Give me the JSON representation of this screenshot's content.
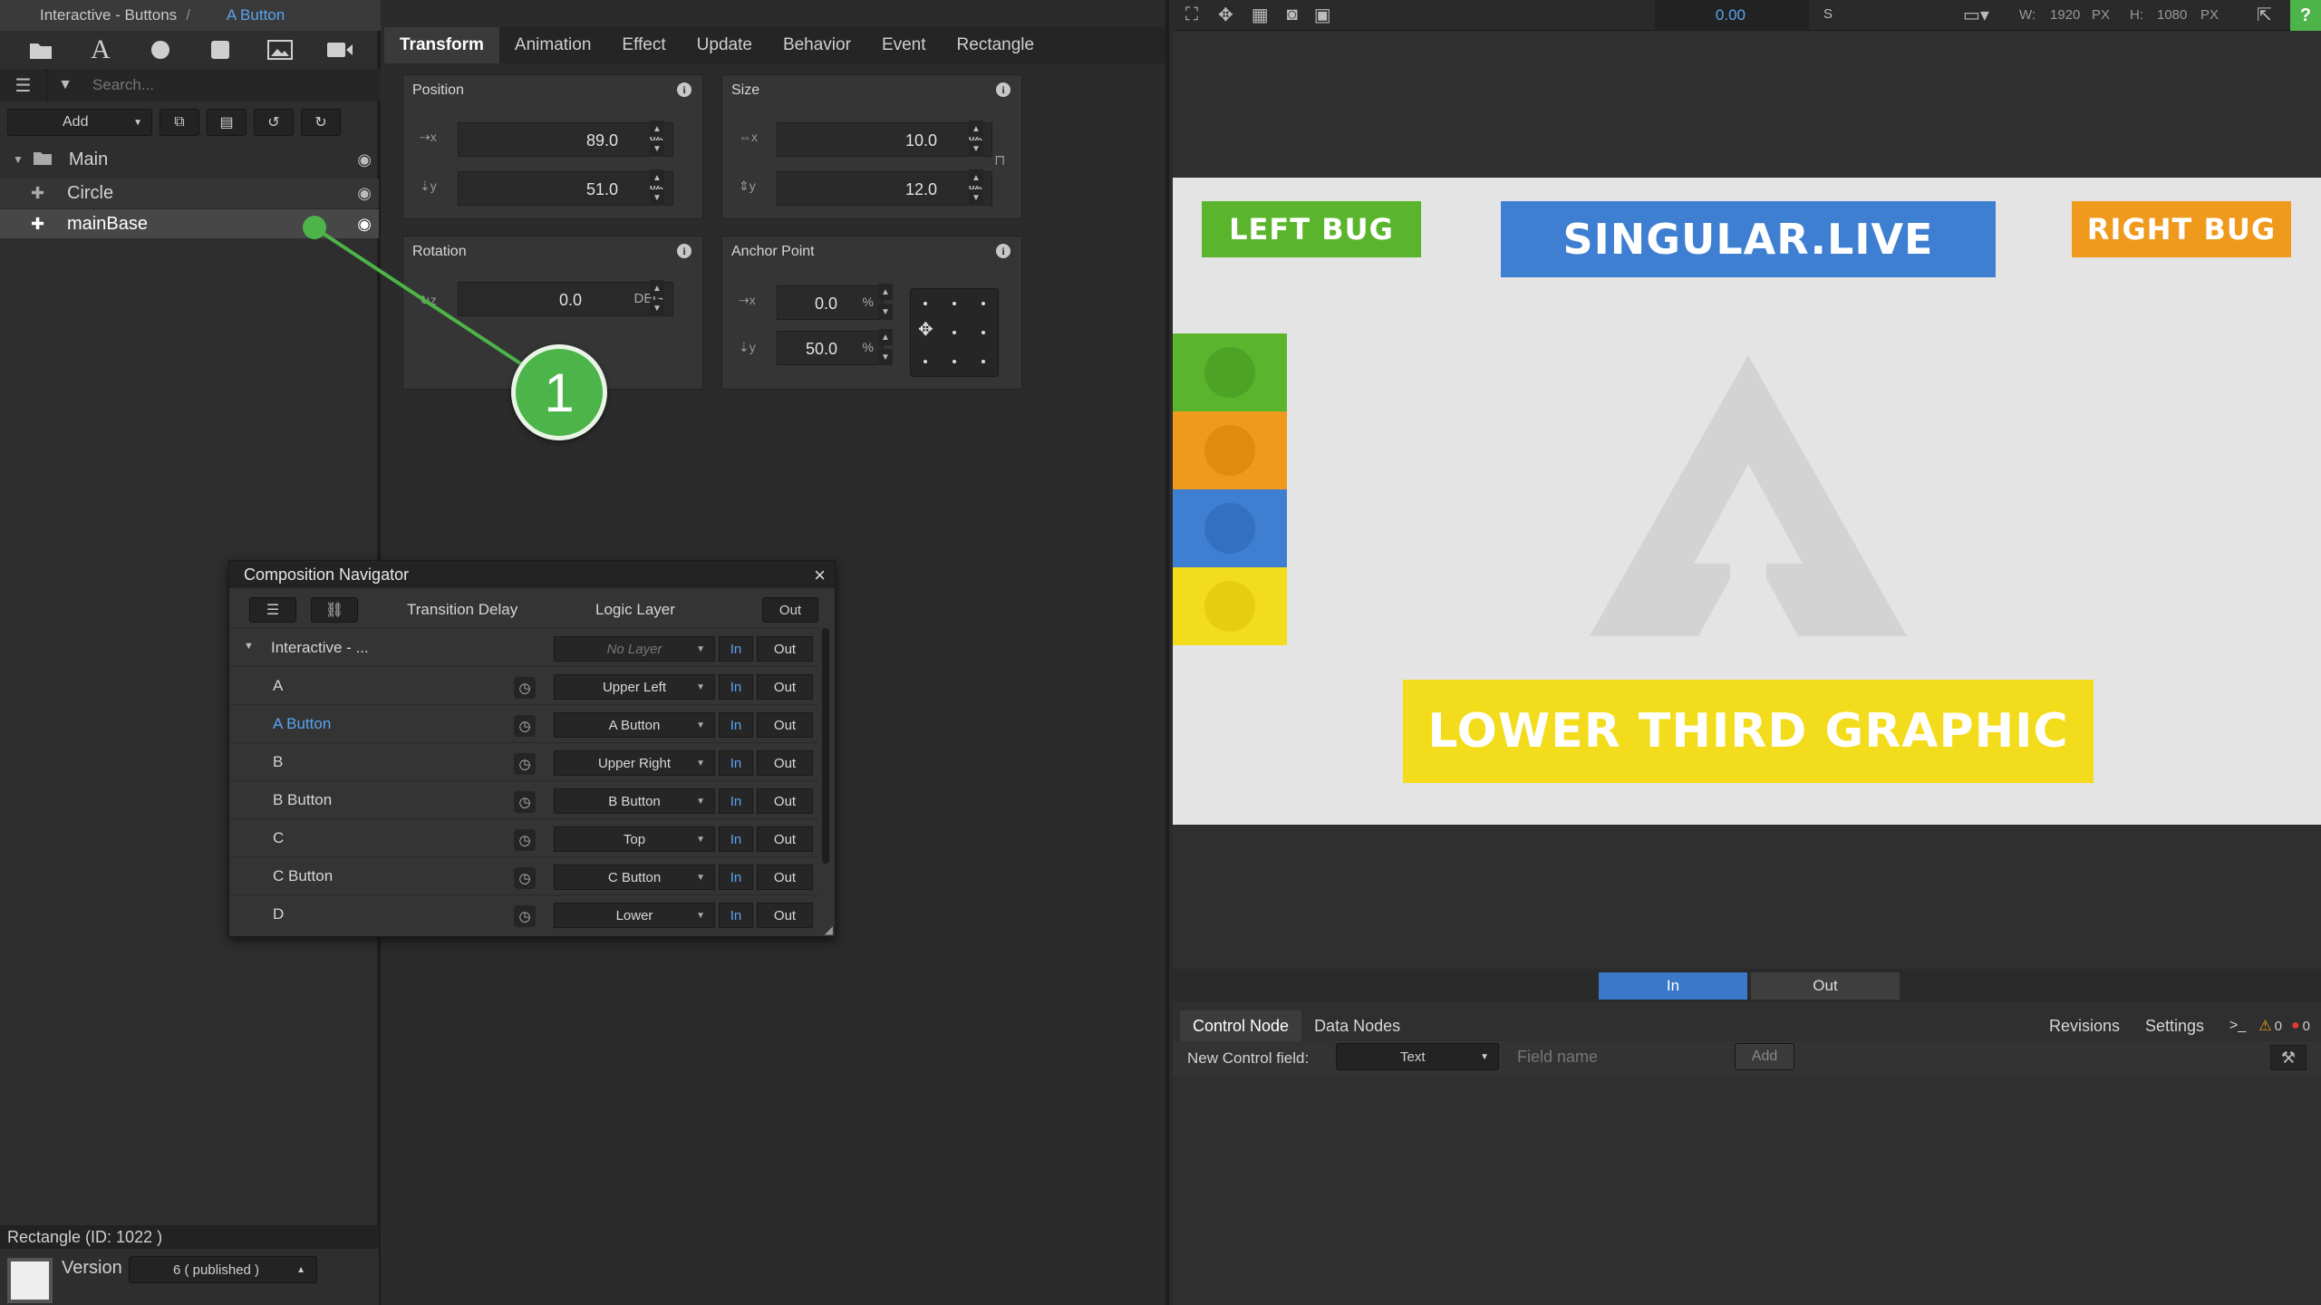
{
  "breadcrumb": {
    "project": "Interactive - Buttons",
    "separator": "/",
    "current": "A Button"
  },
  "toolbar": {
    "icons": [
      "folder-icon",
      "text-icon",
      "circle-icon",
      "square-icon",
      "image-icon",
      "video-icon"
    ],
    "glyphs": [
      "▬",
      "A",
      "●",
      "■",
      "▨",
      "■"
    ]
  },
  "search": {
    "placeholder": "Search..."
  },
  "add_row": {
    "add_label": "Add"
  },
  "tree": {
    "items": [
      {
        "label": "Main",
        "level": 0
      },
      {
        "label": "Circle",
        "level": 1
      },
      {
        "label": "mainBase",
        "level": 1,
        "selected": true
      }
    ]
  },
  "status": {
    "text": "Rectangle (ID: 1022 )"
  },
  "version": {
    "label": "Version",
    "value": "6 ( published )"
  },
  "tabs": [
    "Transform",
    "Animation",
    "Effect",
    "Update",
    "Behavior",
    "Event",
    "Rectangle"
  ],
  "transform": {
    "position": {
      "title": "Position",
      "x": "89.0",
      "y": "51.0",
      "unit": "%"
    },
    "size": {
      "title": "Size",
      "w": "10.0",
      "h": "12.0",
      "unit": "%"
    },
    "rotation": {
      "title": "Rotation",
      "z": "0.0",
      "unit": "DEG"
    },
    "anchor": {
      "title": "Anchor Point",
      "x": "0.0",
      "y": "50.0",
      "unit": "%"
    }
  },
  "annotation": {
    "number": "1",
    "color": "#4cb448"
  },
  "comp_nav": {
    "title": "Composition Navigator",
    "close": "×",
    "head_transition": "Transition Delay",
    "head_logic": "Logic Layer",
    "head_out": "Out",
    "rows": [
      {
        "name": "Interactive - ...",
        "layer": "No Layer",
        "in": "In",
        "out": "Out",
        "group": true
      },
      {
        "name": "A",
        "layer": "Upper Left",
        "in": "In",
        "out": "Out"
      },
      {
        "name": "A Button",
        "layer": "A Button",
        "in": "In",
        "out": "Out",
        "highlight": true
      },
      {
        "name": "B",
        "layer": "Upper Right",
        "in": "In",
        "out": "Out"
      },
      {
        "name": "B Button",
        "layer": "B Button",
        "in": "In",
        "out": "Out"
      },
      {
        "name": "C",
        "layer": "Top",
        "in": "In",
        "out": "Out"
      },
      {
        "name": "C Button",
        "layer": "C Button",
        "in": "In",
        "out": "Out"
      },
      {
        "name": "D",
        "layer": "Lower",
        "in": "In",
        "out": "Out"
      }
    ]
  },
  "topbar": {
    "time": "0.00",
    "time_unit": "S",
    "w_label": "W:",
    "w": "1920",
    "h_label": "H:",
    "h": "1080",
    "unit": "PX",
    "help": "?"
  },
  "stage": {
    "left_bug": "LEFT BUG",
    "center": "SINGULAR.LIVE",
    "right_bug": "RIGHT BUG",
    "lower_third": "LOWER THIRD GRAPHIC",
    "colors": {
      "green": "#5ab52c",
      "blue": "#3f7fd1",
      "orange": "#ef9a1d",
      "yellow": "#f2dc1b"
    }
  },
  "io": {
    "in": "In",
    "out": "Out"
  },
  "bottom": {
    "tabs": [
      "Control Node",
      "Data Nodes"
    ],
    "right_tabs": [
      "Revisions",
      "Settings"
    ],
    "console": ">_",
    "warnings": "0",
    "errors": "0",
    "new_field_label": "New Control field:",
    "type_value": "Text",
    "field_name_placeholder": "Field name",
    "add_label": "Add"
  }
}
